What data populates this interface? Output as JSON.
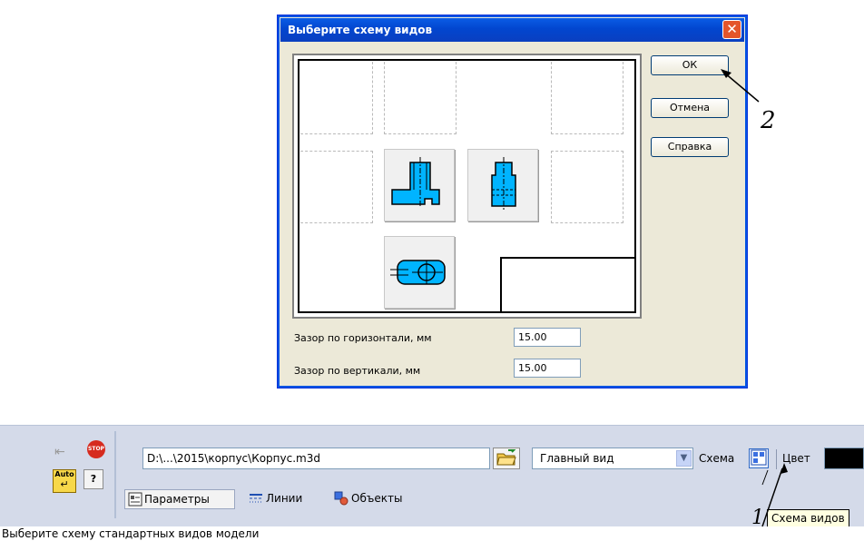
{
  "dialog": {
    "title": "Выберите схему видов",
    "ok_label": "ОК",
    "cancel_label": "Отмена",
    "help_label": "Справка",
    "gap_horizontal_label": "Зазор по горизонтали, мм",
    "gap_horizontal_value": "15.00",
    "gap_vertical_label": "Зазор по вертикали, мм",
    "gap_vertical_value": "15.00"
  },
  "annotations": {
    "marker_ok": "2",
    "marker_scheme": "1"
  },
  "toolbar": {
    "file_path": "D:\\...\\2015\\корпус\\Корпус.m3d",
    "view_select": "Главный вид",
    "scheme_label": "Схема",
    "color_label": "Цвет",
    "tab_params": "Параметры",
    "tab_lines": "Линии",
    "tab_objects": "Объекты",
    "auto_label": "Auto",
    "help_glyph": "?",
    "stop_label": "STOP",
    "tooltip": "Схема видов"
  },
  "status_bar": {
    "text": "Выберите схему стандартных видов модели"
  },
  "colors": {
    "titlebar": "#0a5ce6",
    "model_blue": "#00b4ff",
    "toolbar_bg": "#d4dae9"
  }
}
